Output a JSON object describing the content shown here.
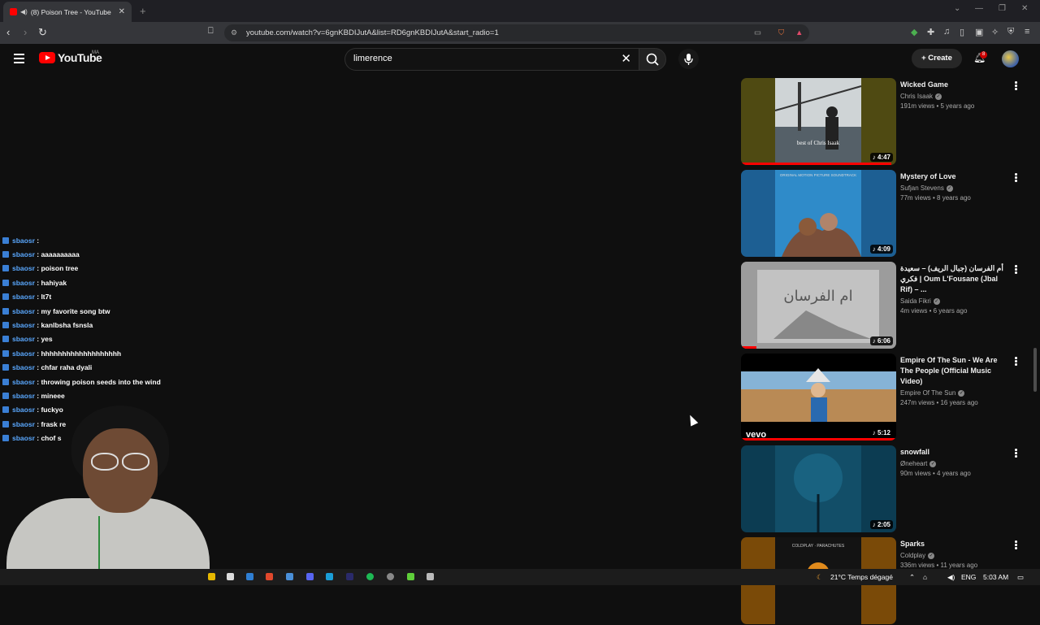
{
  "browser": {
    "tab_title": "(8) Poison Tree - YouTube",
    "url": "youtube.com/watch?v=6gnKBDIJutA&list=RD6gnKBDIJutA&start_radio=1"
  },
  "header": {
    "logo_text": "YouTube",
    "country_code": "MA",
    "search_value": "limerence",
    "create_label": "Create",
    "notification_count": "8"
  },
  "chat": [
    {
      "user": "sbaosr",
      "message": ""
    },
    {
      "user": "sbaosr",
      "message": "aaaaaaaaaa"
    },
    {
      "user": "sbaosr",
      "message": "poison tree"
    },
    {
      "user": "sbaosr",
      "message": "hahiyak"
    },
    {
      "user": "sbaosr",
      "message": "lt7t"
    },
    {
      "user": "sbaosr",
      "message": "my favorite song btw"
    },
    {
      "user": "sbaosr",
      "message": "kanlbsha fsnsla"
    },
    {
      "user": "sbaosr",
      "message": "yes"
    },
    {
      "user": "sbaosr",
      "message": "hhhhhhhhhhhhhhhhhhh"
    },
    {
      "user": "sbaosr",
      "message": "chfar raha dyali"
    },
    {
      "user": "sbaosr",
      "message": "throwing poison seeds into the wind"
    },
    {
      "user": "sbaosr",
      "message": "mineee"
    },
    {
      "user": "sbaosr",
      "message": "fuckyo"
    },
    {
      "user": "sbaosr",
      "message": "frask re"
    },
    {
      "user": "sbaosr",
      "message": "chof s"
    }
  ],
  "playlist": [
    {
      "title": "Wicked Game",
      "channel": "Chris Isaak",
      "views": "191m views • 5 years ago",
      "duration": "4:47",
      "thumb_text": "best of Chris Isaak",
      "progress": 0.97
    },
    {
      "title": "Mystery of Love",
      "channel": "Sufjan Stevens",
      "views": "77m views • 8 years ago",
      "duration": "4:09",
      "thumb_text": "ORIGINAL MOTION PICTURE SOUNDTRACK",
      "progress": 0
    },
    {
      "title": "أم الفرسان (جبال الريف) – سعيدة فكري | Oum L'Fousane (Jbal Rif) – ...",
      "channel": "Saida Fikri",
      "views": "4m views • 6 years ago",
      "duration": "6:06",
      "thumb_text": "ام الفرسان",
      "progress": 0.1
    },
    {
      "title": "Empire Of The Sun - We Are The People (Official Music Video)",
      "channel": "Empire Of The Sun",
      "views": "247m views • 16 years ago",
      "duration": "5:12",
      "thumb_text": "vevo",
      "progress": 1
    },
    {
      "title": "snowfall",
      "channel": "Øneheart",
      "views": "90m views • 4 years ago",
      "duration": "2:05",
      "thumb_text": "",
      "progress": 0
    },
    {
      "title": "Sparks",
      "channel": "Coldplay",
      "views": "336m views • 11 years ago",
      "duration": "",
      "thumb_text": "COLDPLAY · PARACHUTES",
      "progress": 0
    }
  ],
  "taskbar": {
    "weather": "21°C  Temps dégagé",
    "language": "ENG",
    "time": "5:03 AM"
  },
  "colors": {
    "accent": "#ff0000",
    "background": "#0f0f0f",
    "chat_user": "#5aa8ff"
  }
}
